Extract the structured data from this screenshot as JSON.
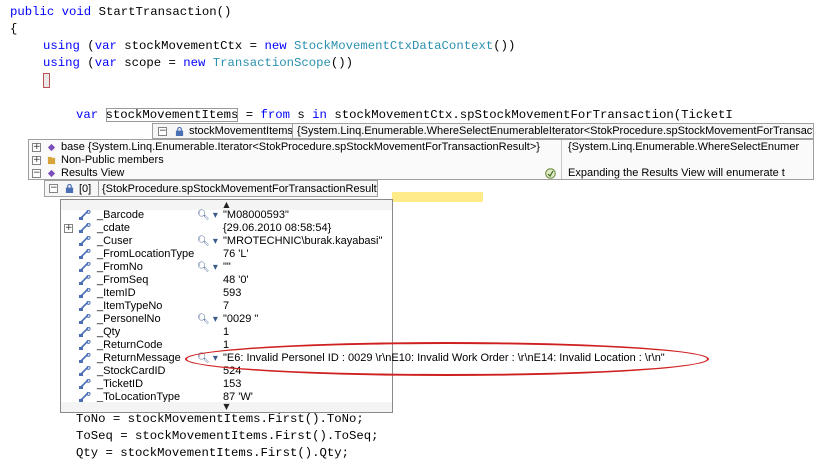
{
  "code": {
    "line1": {
      "kw1": "public",
      "kw2": "void",
      "rest": "StartTransaction()"
    },
    "line2": "{",
    "line3": {
      "using": "using",
      "p1": "(",
      "var": "var",
      "name": "stockMovementCtx = ",
      "new": "new",
      "type": "StockMovementCtxDataContext",
      "end": "())"
    },
    "line4": {
      "using": "using",
      "p1": "(",
      "var": "var",
      "name": "scope = ",
      "new": "new",
      "type": "TransactionScope",
      "end": "())"
    },
    "line6": {
      "var": "var",
      "ident": "stockMovementItems",
      "mid": " = ",
      "from": "from",
      "s": " s ",
      "in": "in",
      "rest": " stockMovementCtx.spStockMovementForTransaction(TicketI"
    },
    "bottom": [
      "ToNo = stockMovementItems.First().ToNo;",
      "ToSeq = stockMovementItems.First().ToSeq;",
      "Qty = stockMovementItems.First().Qty;"
    ]
  },
  "datatip": {
    "header_name": "stockMovementItems",
    "header_value": "{System.Linq.Enumerable.WhereSelectEnumerableIterator<StokProcedure.spStockMovementForTransaction",
    "rows": [
      {
        "name": "base {System.Linq.Enumerable.Iterator<StokProcedure.spStockMovementForTransactionResult>}",
        "value": "{System.Linq.Enumerable.WhereSelectEnumer"
      },
      {
        "name": "Non-Public members",
        "value": ""
      },
      {
        "name": "Results View",
        "value": "Expanding the Results View will enumerate t"
      }
    ],
    "item_label": "[0]",
    "item_value": "{StokProcedure.spStockMovementForTransactionResult}"
  },
  "properties": [
    {
      "name": "_Barcode",
      "value": "\"M08000593\"",
      "viz": true,
      "expand": false
    },
    {
      "name": "_cdate",
      "value": "{29.06.2010 08:58:54}",
      "viz": false,
      "expand": true
    },
    {
      "name": "_Cuser",
      "value": "\"MROTECHNIC\\burak.kayabasi\"",
      "viz": true,
      "expand": false
    },
    {
      "name": "_FromLocationType",
      "value": "76 'L'",
      "viz": false,
      "expand": false
    },
    {
      "name": "_FromNo",
      "value": "\"\"",
      "viz": true,
      "expand": false
    },
    {
      "name": "_FromSeq",
      "value": "48 '0'",
      "viz": false,
      "expand": false
    },
    {
      "name": "_ItemID",
      "value": "593",
      "viz": false,
      "expand": false
    },
    {
      "name": "_ItemTypeNo",
      "value": "7",
      "viz": false,
      "expand": false
    },
    {
      "name": "_PersonelNo",
      "value": "\"0029        \"",
      "viz": true,
      "expand": false
    },
    {
      "name": "_Qty",
      "value": "1",
      "viz": false,
      "expand": false
    },
    {
      "name": "_ReturnCode",
      "value": "1",
      "viz": false,
      "expand": false
    },
    {
      "name": "_ReturnMessage",
      "value": "\"E6: Invalid Personel ID : 0029        \\r\\nE10: Invalid Work Order :   \\r\\nE14: Invalid Location :   \\r\\n\"",
      "viz": true,
      "expand": false
    },
    {
      "name": "_StockCardID",
      "value": "524",
      "viz": false,
      "expand": false
    },
    {
      "name": "_TicketID",
      "value": "153",
      "viz": false,
      "expand": false
    },
    {
      "name": "_ToLocationType",
      "value": "87 'W'",
      "viz": false,
      "expand": false
    }
  ],
  "icons": {
    "property": "wrench-icon",
    "visualizer": "magnifier-icon",
    "lock": "lock-icon",
    "info": "info-icon",
    "scroll_up": "triangle-up-icon",
    "scroll_down": "triangle-down-icon"
  },
  "colors": {
    "keyword": "#0000ff",
    "type": "#2b91af",
    "highlight_ellipse": "#cf2020"
  }
}
